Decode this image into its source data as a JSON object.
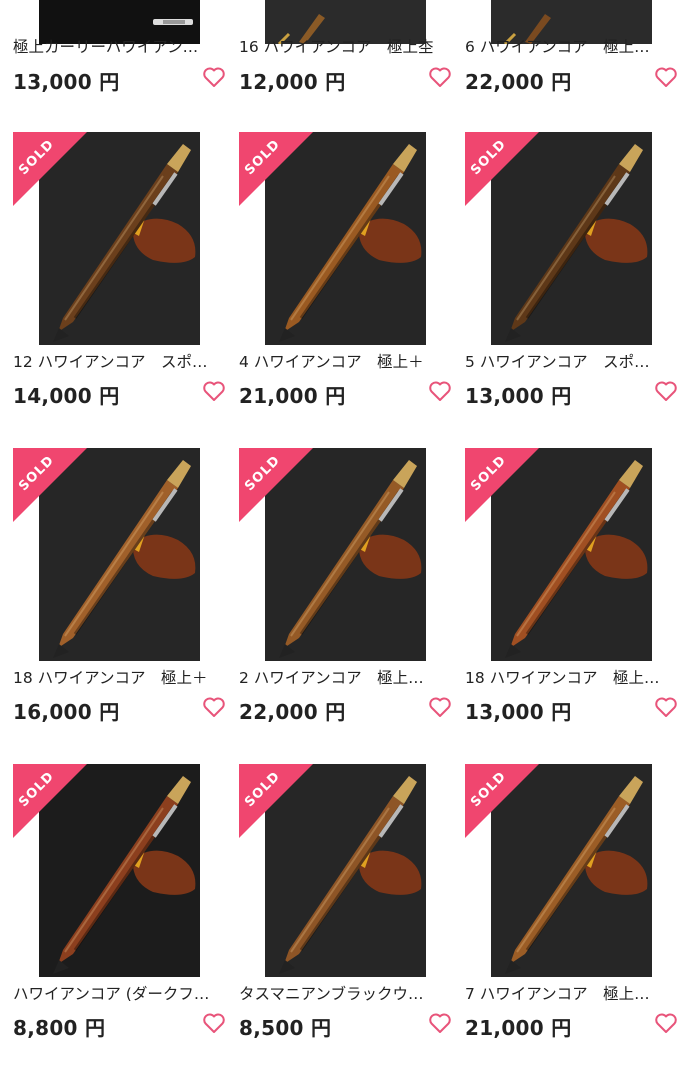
{
  "colors": {
    "sold_ribbon": "#f0466f",
    "heart": "#e8547a",
    "text": "#222222"
  },
  "sold_label": "SOLD",
  "top_row": [
    {
      "title": "極上カーリーハワイアン…",
      "price": "13,000 円",
      "sold": false
    },
    {
      "title": "16 ハワイアンコア　極上杢",
      "price": "12,000 円",
      "sold": false
    },
    {
      "title": "6 ハワイアンコア　極上…",
      "price": "22,000 円",
      "sold": false
    }
  ],
  "items": [
    {
      "title": "12 ハワイアンコア　スポ…",
      "price": "14,000 円",
      "sold": true,
      "wood": "#6b3f1c"
    },
    {
      "title": "4 ハワイアンコア　極上＋",
      "price": "21,000 円",
      "sold": true,
      "wood": "#9a5a22"
    },
    {
      "title": "5 ハワイアンコア　スポ…",
      "price": "13,000 円",
      "sold": true,
      "wood": "#5e3818"
    },
    {
      "title": "18 ハワイアンコア　極上＋",
      "price": "16,000 円",
      "sold": true,
      "wood": "#a0602a"
    },
    {
      "title": "2 ハワイアンコア　極上…",
      "price": "22,000 円",
      "sold": true,
      "wood": "#955a26"
    },
    {
      "title": "18 ハワイアンコア　極上…",
      "price": "13,000 円",
      "sold": true,
      "wood": "#a04f22"
    },
    {
      "title": "ハワイアンコア (ダークフ…",
      "price": "8,800 円",
      "sold": true,
      "wood": "#8c3f1e"
    },
    {
      "title": "タスマニアンブラックウ…",
      "price": "8,500 円",
      "sold": true,
      "wood": "#8e5526"
    },
    {
      "title": "7 ハワイアンコア　極上…",
      "price": "21,000 円",
      "sold": true,
      "wood": "#9b5d26"
    }
  ]
}
